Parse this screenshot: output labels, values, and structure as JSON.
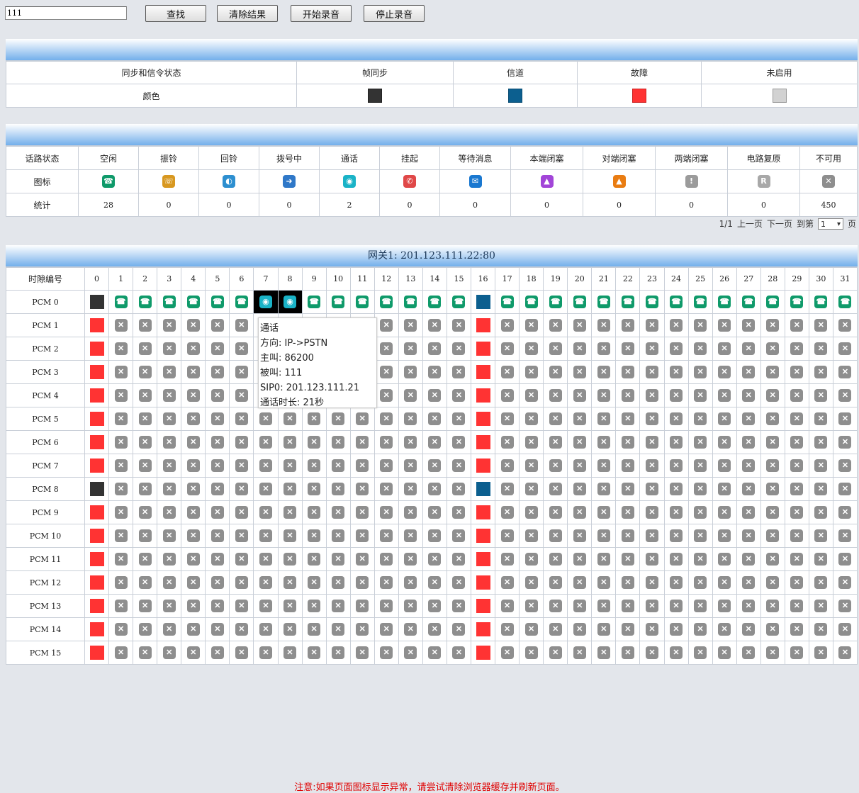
{
  "toolbar": {
    "search_value": "111",
    "find_label": "查找",
    "clear_label": "清除结果",
    "start_rec_label": "开始录音",
    "stop_rec_label": "停止录音"
  },
  "sync_table": {
    "header_label": "同步和信令状态",
    "color_label": "颜色",
    "states": [
      {
        "label": "帧同步",
        "swatch": "black",
        "color": "#333333"
      },
      {
        "label": "信道",
        "swatch": "blue",
        "color": "#0c5f8f"
      },
      {
        "label": "故障",
        "swatch": "red",
        "color": "#ff3333"
      },
      {
        "label": "未启用",
        "swatch": "gray",
        "color": "#d2d2d2"
      }
    ]
  },
  "line_table": {
    "row_labels": {
      "status": "话路状态",
      "icon": "图标",
      "stats": "统计"
    },
    "columns": [
      {
        "label": "空闲",
        "icon": "idle-icon",
        "count": "28"
      },
      {
        "label": "振铃",
        "icon": "ringing-icon",
        "count": "0"
      },
      {
        "label": "回铃",
        "icon": "ringback-icon",
        "count": "0"
      },
      {
        "label": "拨号中",
        "icon": "dialing-icon",
        "count": "0"
      },
      {
        "label": "通话",
        "icon": "talking-icon",
        "count": "2"
      },
      {
        "label": "挂起",
        "icon": "hangup-icon",
        "count": "0"
      },
      {
        "label": "等待消息",
        "icon": "waiting-icon",
        "count": "0"
      },
      {
        "label": "本端闭塞",
        "icon": "local-block-icon",
        "count": "0"
      },
      {
        "label": "对端闭塞",
        "icon": "remote-block-icon",
        "count": "0"
      },
      {
        "label": "两端闭塞",
        "icon": "both-block-icon",
        "count": "0"
      },
      {
        "label": "电路复原",
        "icon": "reset-icon",
        "count": "0"
      },
      {
        "label": "不可用",
        "icon": "unavailable-icon",
        "count": "450"
      }
    ]
  },
  "pager": {
    "info": "1/1",
    "prev": "上一页",
    "next": "下一页",
    "goto": "到第",
    "page_value": "1",
    "page_suffix": "页"
  },
  "gateway": {
    "title": "网关1: 201.123.111.22:80",
    "slot_header": "时隙编号",
    "slots": [
      "0",
      "1",
      "2",
      "3",
      "4",
      "5",
      "6",
      "7",
      "8",
      "9",
      "10",
      "11",
      "12",
      "13",
      "14",
      "15",
      "16",
      "17",
      "18",
      "19",
      "20",
      "21",
      "22",
      "23",
      "24",
      "25",
      "26",
      "27",
      "28",
      "29",
      "30",
      "31"
    ],
    "rows": [
      {
        "label": "PCM 0",
        "col0": "black",
        "col16": "blue",
        "default": "idle",
        "talking": [
          7,
          8
        ]
      },
      {
        "label": "PCM 1",
        "col0": "red",
        "col16": "red",
        "default": "na"
      },
      {
        "label": "PCM 2",
        "col0": "red",
        "col16": "red",
        "default": "na"
      },
      {
        "label": "PCM 3",
        "col0": "red",
        "col16": "red",
        "default": "na"
      },
      {
        "label": "PCM 4",
        "col0": "red",
        "col16": "red",
        "default": "na"
      },
      {
        "label": "PCM 5",
        "col0": "red",
        "col16": "red",
        "default": "na"
      },
      {
        "label": "PCM 6",
        "col0": "red",
        "col16": "red",
        "default": "na"
      },
      {
        "label": "PCM 7",
        "col0": "red",
        "col16": "red",
        "default": "na"
      },
      {
        "label": "PCM 8",
        "col0": "black",
        "col16": "blue",
        "default": "na"
      },
      {
        "label": "PCM 9",
        "col0": "red",
        "col16": "red",
        "default": "na"
      },
      {
        "label": "PCM 10",
        "col0": "red",
        "col16": "red",
        "default": "na"
      },
      {
        "label": "PCM 11",
        "col0": "red",
        "col16": "red",
        "default": "na"
      },
      {
        "label": "PCM 12",
        "col0": "red",
        "col16": "red",
        "default": "na"
      },
      {
        "label": "PCM 13",
        "col0": "red",
        "col16": "red",
        "default": "na"
      },
      {
        "label": "PCM 14",
        "col0": "red",
        "col16": "red",
        "default": "na"
      },
      {
        "label": "PCM 15",
        "col0": "red",
        "col16": "red",
        "default": "na"
      }
    ]
  },
  "tooltip": {
    "lines": [
      "通话",
      "方向: IP->PSTN",
      "主叫: 86200",
      "被叫: 111",
      "SIP0: 201.123.111.21",
      "通话时长: 21秒"
    ]
  },
  "notice": "注意:如果页面图标显示异常，请尝试清除浏览器缓存并刷新页面。"
}
